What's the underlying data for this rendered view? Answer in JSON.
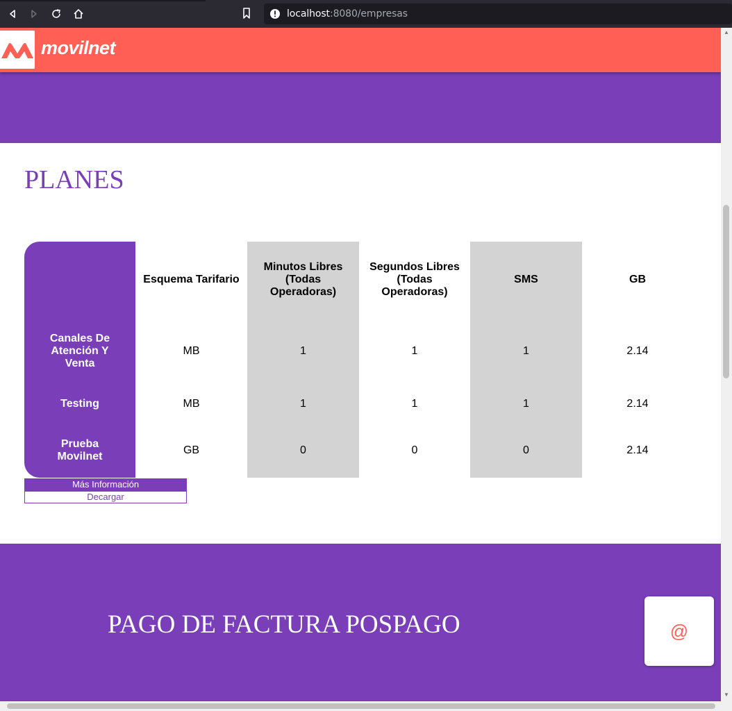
{
  "browser": {
    "url_host": "localhost",
    "url_rest": ":8080/empresas"
  },
  "header": {
    "logo_text": "movilnet"
  },
  "planes": {
    "title": "PLANES",
    "headers": [
      "Esquema Tarifario",
      "Minutos Libres (Todas Operadoras)",
      "Segundos Libres (Todas Operadoras)",
      "SMS",
      "GB"
    ],
    "rows": [
      {
        "label": "Canales De Atención Y Venta",
        "values": [
          "MB",
          "1",
          "1",
          "1",
          "2.14"
        ]
      },
      {
        "label": "Testing",
        "values": [
          "MB",
          "1",
          "1",
          "1",
          "2.14"
        ]
      },
      {
        "label": "Prueba Movilnet",
        "values": [
          "GB",
          "0",
          "0",
          "0",
          "2.14"
        ]
      }
    ],
    "mas_info_label": "Más Información",
    "descargar_label": "Decargar"
  },
  "pago": {
    "title": "PAGO DE FACTURA POSPAGO"
  },
  "float_button": {
    "symbol": "@"
  },
  "colors": {
    "brand_red": "#ff5f55",
    "brand_purple": "#7a3eb8",
    "cell_gray": "#d3d3d3"
  }
}
